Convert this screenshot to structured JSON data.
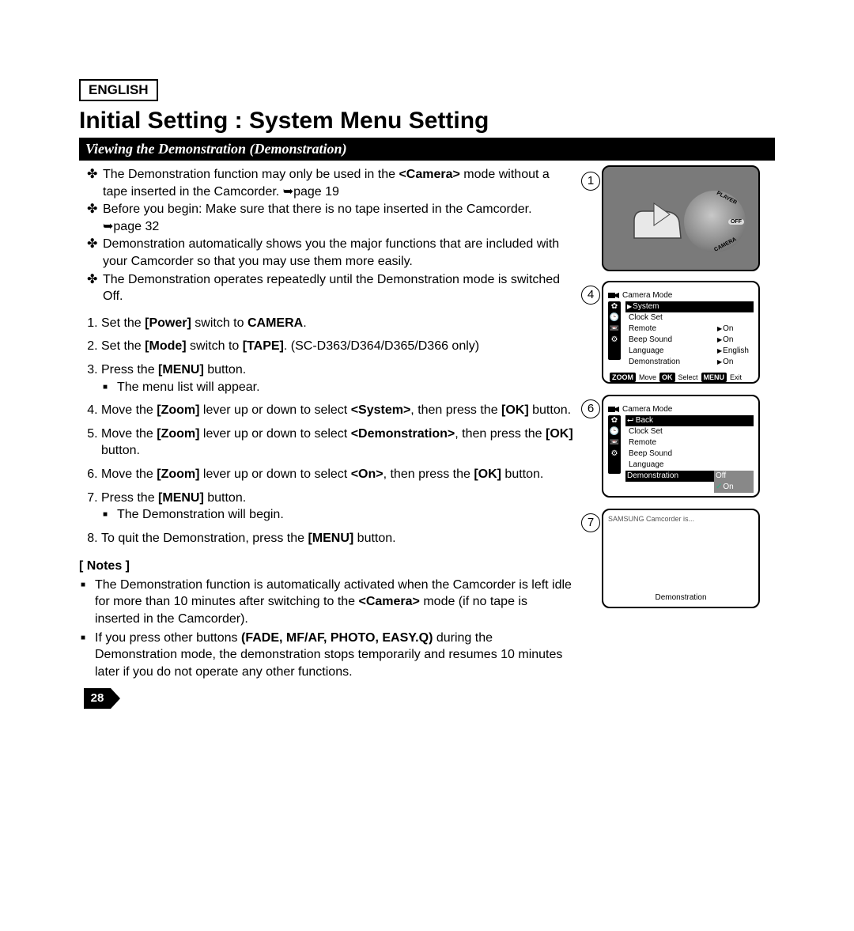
{
  "lang": "ENGLISH",
  "title": "Initial Setting : System Menu Setting",
  "subtitle": "Viewing the Demonstration (Demonstration)",
  "bullets": [
    {
      "pre": "The Demonstration function may only be used in the ",
      "b1": "<Camera>",
      "post": " mode without a tape inserted in the Camcorder. ",
      "ref": "➥page 19"
    },
    {
      "pre": "Before you begin: Make sure that there is no tape inserted in the Camcorder. ",
      "ref": "➥page 32"
    },
    {
      "pre": "Demonstration automatically shows you the major functions that are included with your Camcorder so that you may use them more easily."
    },
    {
      "pre": "The Demonstration operates repeatedly until the Demonstration mode is switched Off."
    }
  ],
  "steps": {
    "s1": {
      "a": "Set the ",
      "b": "[Power]",
      "c": " switch to ",
      "d": "CAMERA",
      "e": "."
    },
    "s2": {
      "a": "Set the ",
      "b": "[Mode]",
      "c": " switch to ",
      "d": "[TAPE]",
      "e": ". (SC-D363/D364/D365/D366 only)"
    },
    "s3": {
      "a": "Press the ",
      "b": "[MENU]",
      "c": " button.",
      "sub": "The menu list will appear."
    },
    "s4": {
      "a": "Move the ",
      "b": "[Zoom]",
      "c": " lever up or down to select ",
      "d": "<System>",
      "e": ", then press the ",
      "f": "[OK]",
      "g": " button."
    },
    "s5": {
      "a": "Move the ",
      "b": "[Zoom]",
      "c": " lever up or down to select ",
      "d": "<Demonstration>",
      "e": ", then press the ",
      "f": "[OK]",
      "g": " button."
    },
    "s6": {
      "a": "Move the ",
      "b": "[Zoom]",
      "c": " lever up or down to select ",
      "d": "<On>",
      "e": ", then press the ",
      "f": "[OK]",
      "g": " button."
    },
    "s7": {
      "a": "Press the ",
      "b": "[MENU]",
      "c": " button.",
      "sub": "The Demonstration will begin."
    },
    "s8": {
      "a": "To quit the Demonstration, press the ",
      "b": "[MENU]",
      "c": " button."
    }
  },
  "notes_h": "[ Notes ]",
  "notes": [
    {
      "a": "The Demonstration function is automatically activated when the Camcorder is left idle for more than 10 minutes after switching to the ",
      "b": "<Camera>",
      "c": " mode (if no tape is inserted in the Camcorder)."
    },
    {
      "a": "If you press other buttons ",
      "b": "(FADE, MF/AF, PHOTO, EASY.Q)",
      "c": " during the Demonstration mode, the demonstration stops temporarily and resumes 10 minutes later if you do not operate any other functions."
    }
  ],
  "page_number": "28",
  "fig": {
    "n1": "1",
    "n4": "4",
    "n6": "6",
    "n7": "7"
  },
  "dial": {
    "player": "PLAYER",
    "off": "OFF",
    "camera": "CAMERA"
  },
  "osd": {
    "mode": "Camera Mode",
    "system": "System",
    "clock": "Clock Set",
    "remote": "Remote",
    "beep": "Beep Sound",
    "language": "Language",
    "demo": "Demonstration",
    "on": "On",
    "english": "English",
    "back": "Back",
    "off": "Off",
    "zoom": "ZOOM",
    "move": "Move",
    "ok": "OK",
    "select": "Select",
    "menu": "MENU",
    "exit": "Exit",
    "demo_top": "SAMSUNG Camcorder is...",
    "demo_bot": "Demonstration"
  }
}
